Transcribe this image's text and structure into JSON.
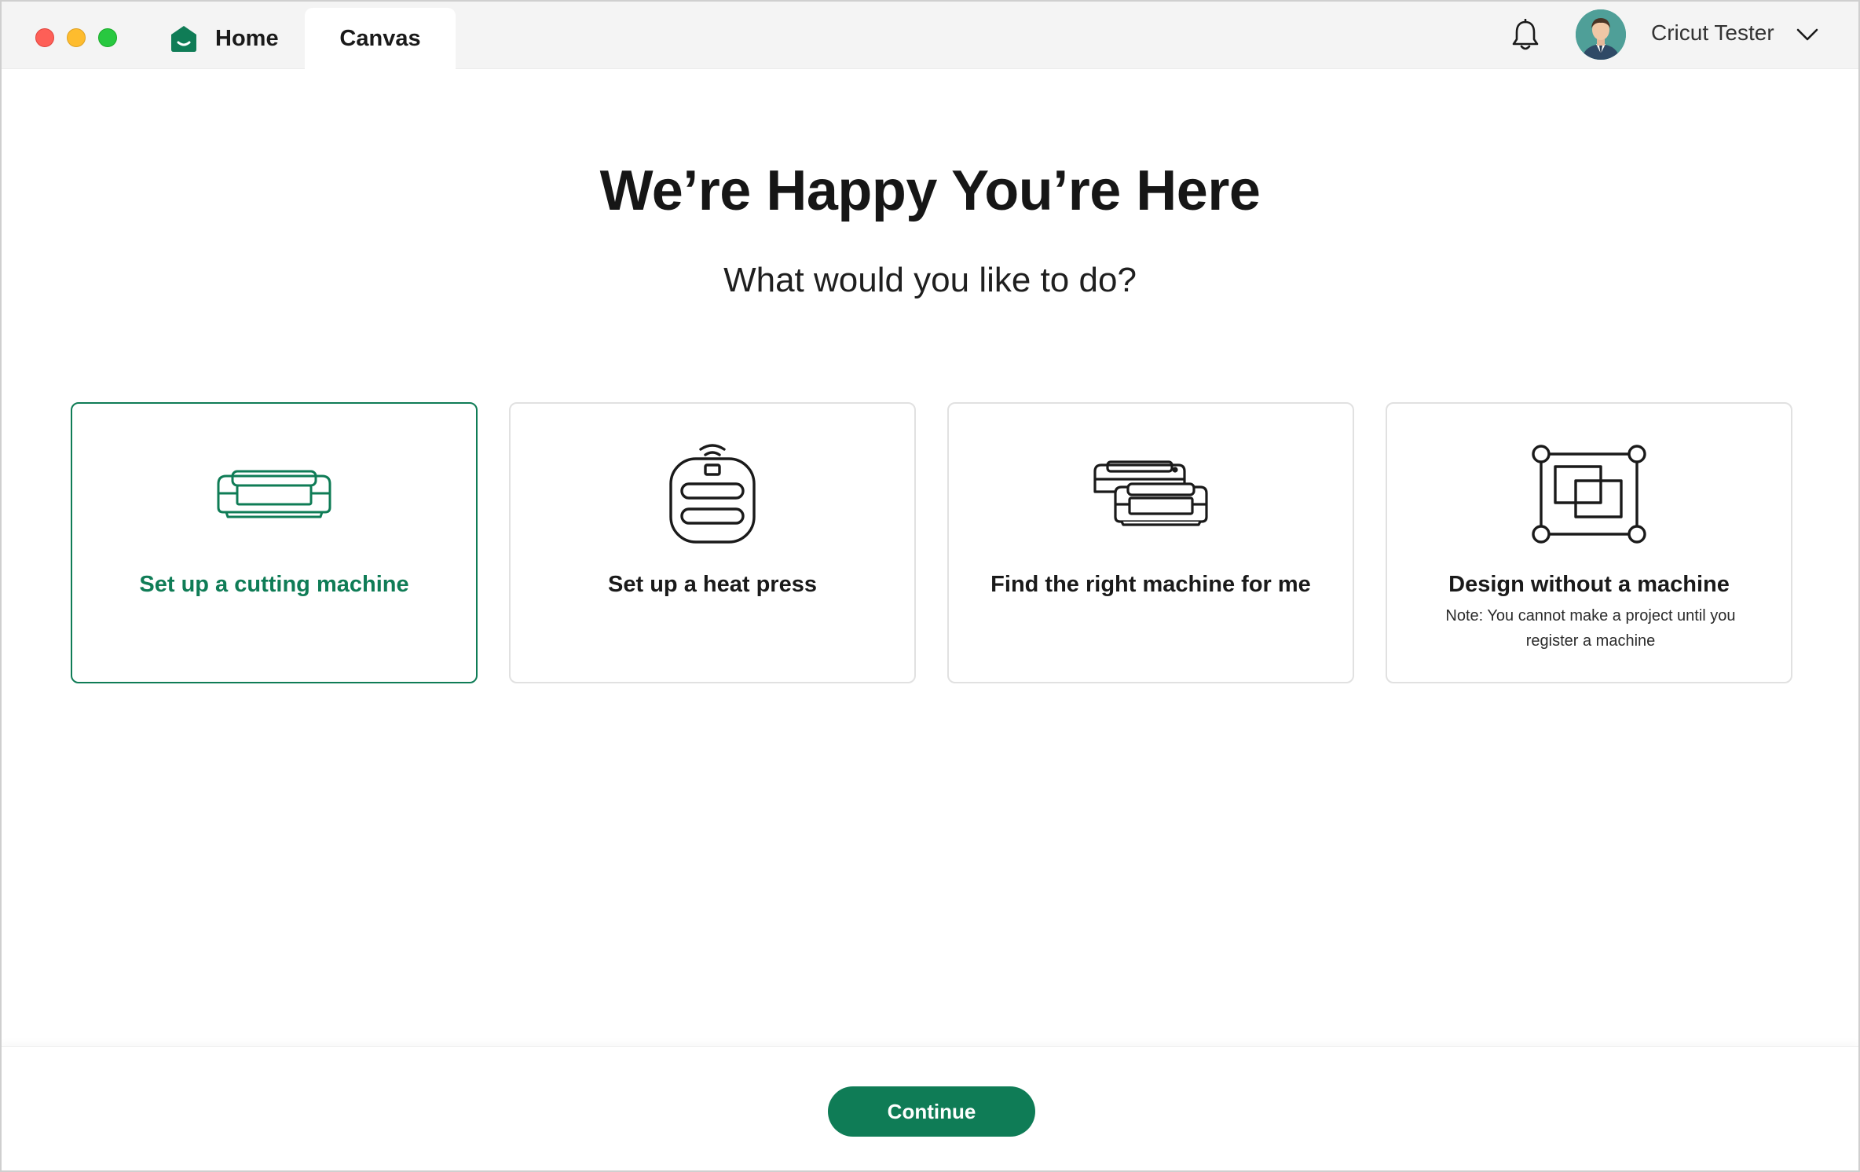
{
  "tabs": [
    {
      "label": "Home",
      "icon": "home-icon"
    },
    {
      "label": "Canvas"
    }
  ],
  "header": {
    "user_name": "Cricut Tester",
    "notification_icon": "bell-icon",
    "menu_icon": "chevron-down-icon"
  },
  "main": {
    "title": "We’re Happy You’re Here",
    "subtitle": "What would you like to do?"
  },
  "options": [
    {
      "label": "Set up a cutting machine",
      "icon": "cutting-machine-icon",
      "selected": true
    },
    {
      "label": "Set up a heat press",
      "icon": "heat-press-icon",
      "selected": false
    },
    {
      "label": "Find the right machine for me",
      "icon": "machines-icon",
      "selected": false
    },
    {
      "label": "Design without a machine",
      "note": "Note: You cannot make a project until you register a machine",
      "icon": "design-canvas-icon",
      "selected": false
    }
  ],
  "footer": {
    "continue_label": "Continue"
  },
  "colors": {
    "accent": "#0f7c56",
    "card_border": "#e1e1e1",
    "titlebar": "#f4f4f4"
  }
}
